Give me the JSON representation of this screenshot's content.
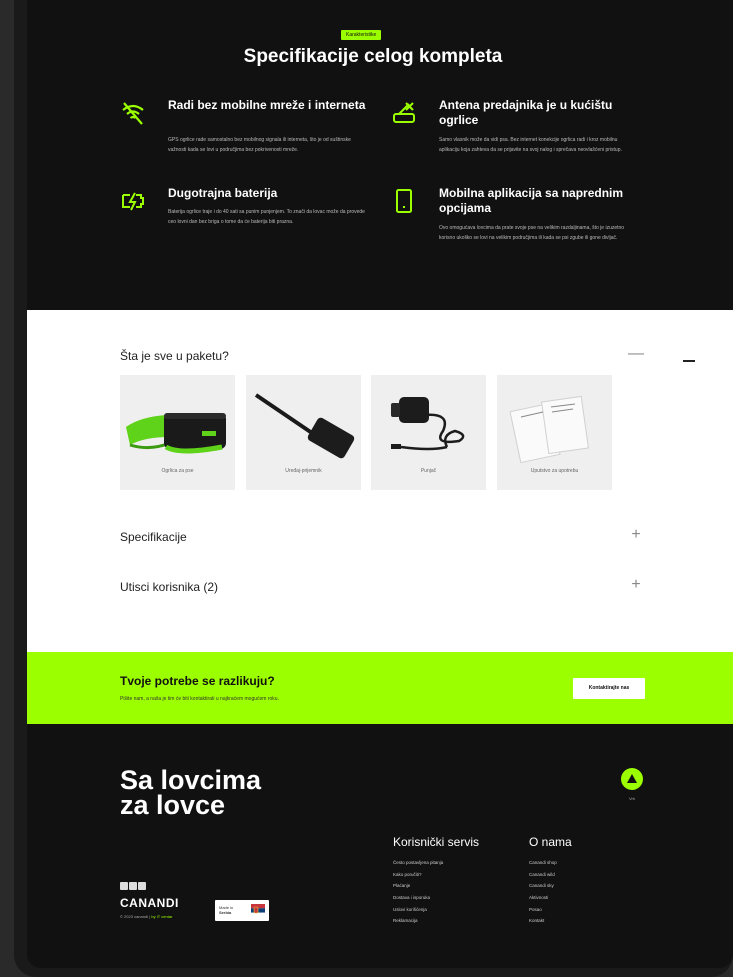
{
  "specs": {
    "badge": "Karakteristike",
    "title": "Specifikacije celog kompleta",
    "features": [
      {
        "icon": "no-network-icon",
        "title": "Radi bez mobilne mreže i interneta",
        "text": "GPS ogrlice rade samostalno bez mobilnog signala ili interneta, što je od suštinske važnosti kada se lovi u područjima bez pokrivenosti mreže."
      },
      {
        "icon": "antenna-collar-icon",
        "title": "Antena predajnika je u kućištu ogrlice",
        "text": "Samo vlasnik može da vidi psa. Bez internet konekcije ogrlica radi i kroz mobilnu aplikaciju koja zahteva da se prijavite na svoj nalog i sprečava neovlašćeni pristup."
      },
      {
        "icon": "battery-charge-icon",
        "title": "Dugotrajna baterija",
        "text": "Baterija ogrlice traje i do 40 sati sa punim punjenjem. To znači da lovac može da provede ceo lovni dan bez briga o tome da će baterija biti prazna."
      },
      {
        "icon": "mobile-phone-icon",
        "title": "Mobilna aplikacija sa naprednim opcijama",
        "text": "Ovo omogućava lovcima da prate svoje pse na velikim razdaljinama, što je izuzetno korisno ukoliko se lovi na velikim područjima ili kada se psi zgube ili gone divljač."
      }
    ]
  },
  "package": {
    "title": "Šta je sve u paketu?",
    "collapse_symbol": "—",
    "items": [
      {
        "label": "Ogrlica za pse",
        "icon": "collar-icon"
      },
      {
        "label": "Uređaj-prijemnik",
        "icon": "receiver-icon"
      },
      {
        "label": "Punjač",
        "icon": "charger-icon"
      },
      {
        "label": "Uputstvo za upotrebu",
        "icon": "manual-icon"
      }
    ],
    "specs_label": "Specifikacije",
    "reviews_label": "Utisci korisnika (2)",
    "expand_symbol": "+"
  },
  "cta": {
    "title": "Tvoje potrebe se razlikuju?",
    "text": "Pišite nam, a naša je tim će biti kontaktirati u najkraćem mogućem roku.",
    "button": "Kontaktirajte nas"
  },
  "footer": {
    "slogan_line1": "Sa lovcima",
    "slogan_line2": "za lovce",
    "top_label": "Vrh",
    "service_title": "Korisnički servis",
    "service_links": [
      "Često postavljena pitanja",
      "Kako poručiti?",
      "Plaćanje",
      "Dostava i isporuka",
      "Uslovi korišćenja",
      "Reklamacija"
    ],
    "about_title": "O nama",
    "about_links": [
      "Canandi shop",
      "Canandi wild",
      "Canandi sky",
      "Aktivnosti",
      "Posao",
      "Kontakt"
    ],
    "logo": "CANANDI",
    "copyright": "© 2023 canandi |",
    "copyright_by": "by IT centar",
    "made_in_line1": "Made in",
    "made_in_line2": "Serbia"
  },
  "colors": {
    "accent": "#9cff00",
    "dark": "#111111"
  }
}
